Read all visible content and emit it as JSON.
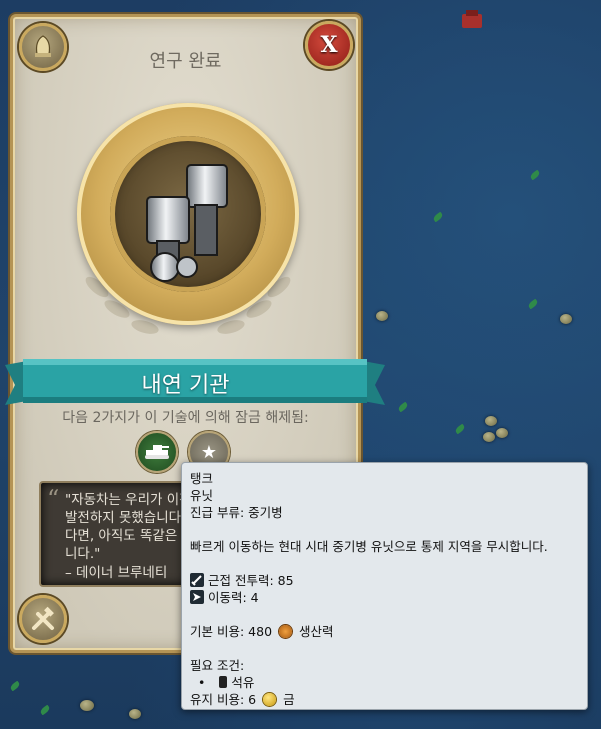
{
  "panel": {
    "title": "연구 완료",
    "tech_name": "내연 기관",
    "unlock_text": "다음 2가지가 이 기술에 의해 잠금 해제됨:",
    "unlock_icons": [
      "tank-icon",
      "star-icon"
    ],
    "quote": "\"자동차는 우리가 이전에 보다 크게\n발전하지 못했습니다. 또 다른\n다면, 아직도 똑같은 것을 하고 있을 것\n니다.\"",
    "quote_author": "– 데이너 브루네티",
    "close_icon": "X"
  },
  "tooltip": {
    "name": "탱크",
    "type": "유닛",
    "promotion_class": "진급 부류: 중기병",
    "description": "빠르게 이동하는 현대 시대 중기병 유닛으로 통제 지역을 무시합니다.",
    "melee_strength": "근접 전투력: 85",
    "movement": "이동력: 4",
    "base_cost": "기본 비용: 480",
    "cost_unit": "생산력",
    "requirements_header": "필요 조건:",
    "requirement_bullet": "•",
    "requirement_item": "석유",
    "maintenance": "유지 비용: 6",
    "maintenance_unit": "금"
  },
  "colors": {
    "banner": "#2aa3a5",
    "gold": "#c9a455",
    "tooltip_bg": "#e3e8ec"
  }
}
